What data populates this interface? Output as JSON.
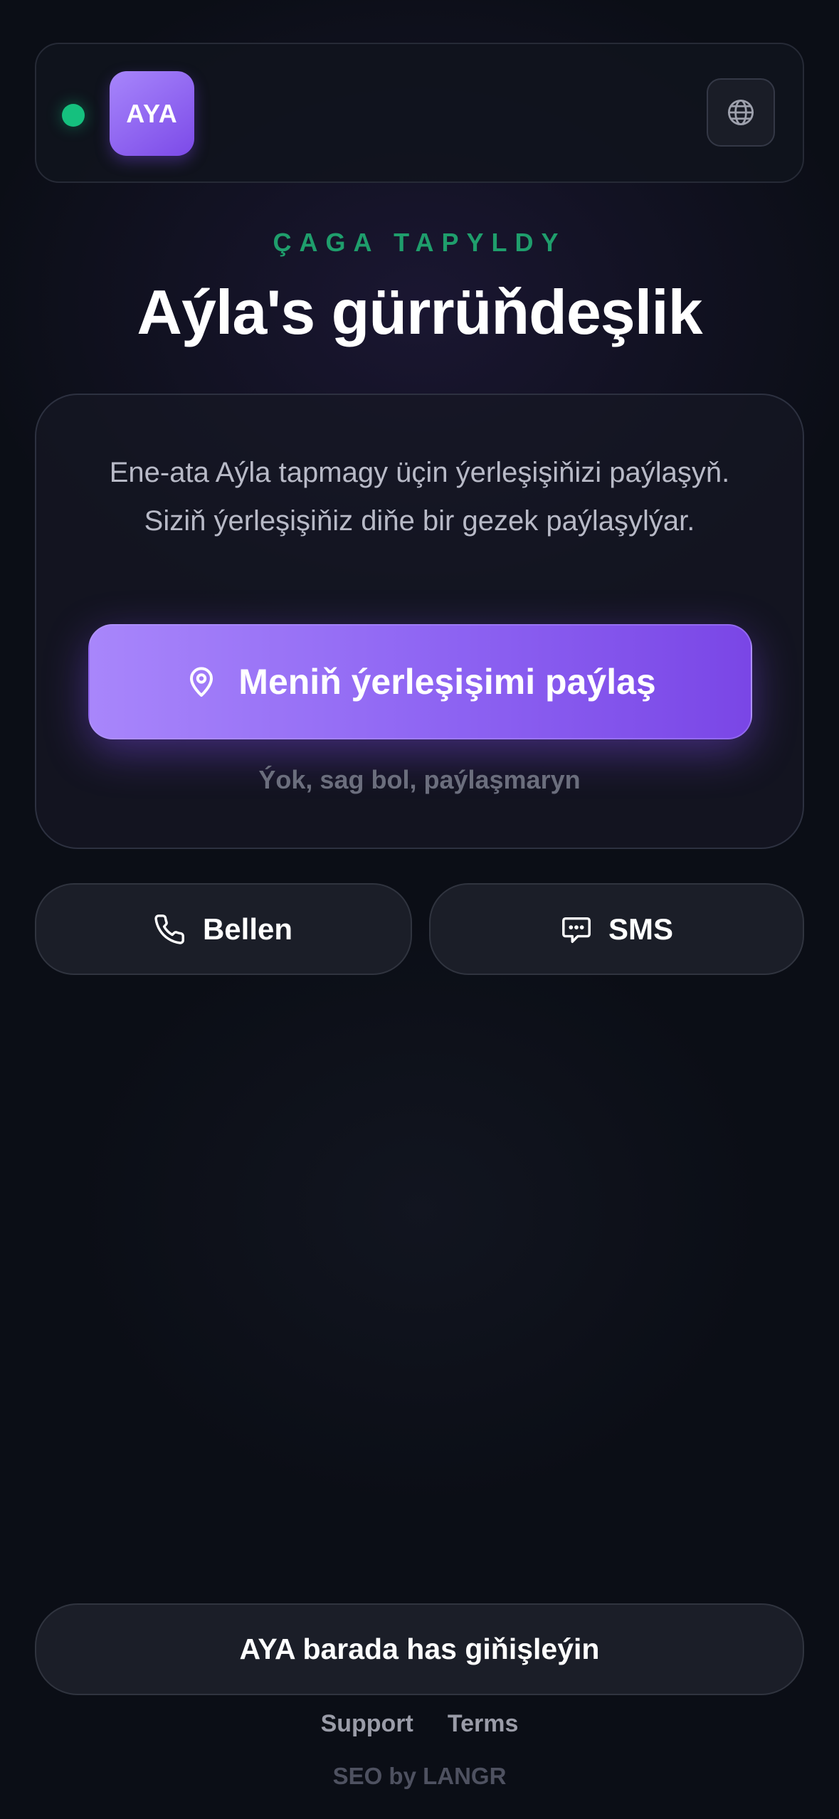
{
  "header": {
    "logo_text": "AYA",
    "status": "online",
    "status_color": "#15c07e",
    "language_icon": "globe-icon"
  },
  "hero": {
    "eyebrow": "ÇAGA TAPYLDY",
    "title": "Aýla's gürrüňdeşlik"
  },
  "share_card": {
    "description": "Ene-ata Aýla tapmagy üçin ýerleşişiňizi paýlaşyň. Siziň ýerleşişiňiz diňe bir gezek paýlaşylýar.",
    "share_button_label": "Meniň ýerleşişimi paýlaş",
    "share_button_icon": "location-pin-icon",
    "decline_label": "Ýok, sag bol, paýlaşmaryn"
  },
  "contact": {
    "call_label": "Bellen",
    "call_icon": "phone-icon",
    "sms_label": "SMS",
    "sms_icon": "chat-bubble-icon"
  },
  "footer": {
    "learn_more_label": "AYA barada has giňişleýin",
    "support_label": "Support",
    "terms_label": "Terms",
    "powered_by": "SEO by LANGR"
  },
  "colors": {
    "accent": "#8d63f2",
    "success": "#15c07e",
    "background": "#0b0e16"
  }
}
